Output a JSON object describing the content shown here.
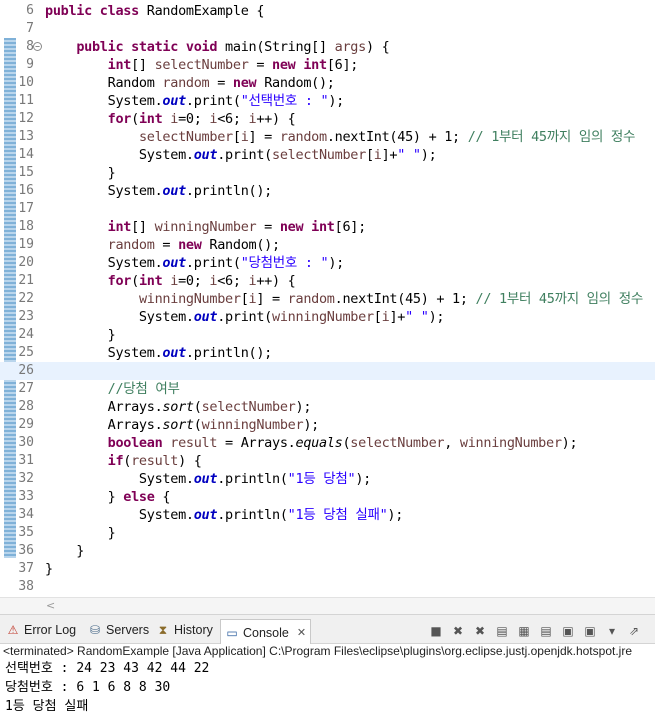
{
  "editor": {
    "lines": [
      {
        "n": "6",
        "tokens": [
          [
            "kw",
            "public class "
          ],
          [
            "",
            "RandomExample {"
          ]
        ]
      },
      {
        "n": "7",
        "tokens": []
      },
      {
        "n": "8",
        "fold": "⊖",
        "tokens": [
          [
            "",
            "    "
          ],
          [
            "kw",
            "public static void "
          ],
          [
            "",
            "main(String[] "
          ],
          [
            "var",
            "args"
          ],
          [
            "",
            ") {"
          ]
        ]
      },
      {
        "n": "9",
        "tokens": [
          [
            "",
            "        "
          ],
          [
            "kw",
            "int"
          ],
          [
            "",
            "[] "
          ],
          [
            "var",
            "selectNumber"
          ],
          [
            "",
            " = "
          ],
          [
            "kw",
            "new int"
          ],
          [
            "",
            "[6];"
          ]
        ]
      },
      {
        "n": "10",
        "tokens": [
          [
            "",
            "        Random "
          ],
          [
            "var",
            "random"
          ],
          [
            "",
            " = "
          ],
          [
            "kw",
            "new "
          ],
          [
            "",
            "Random();"
          ]
        ]
      },
      {
        "n": "11",
        "tokens": [
          [
            "",
            "        System."
          ],
          [
            "fld",
            "out"
          ],
          [
            "",
            ".print("
          ],
          [
            "str",
            "\"선택번호 : \""
          ],
          [
            "",
            ");"
          ]
        ]
      },
      {
        "n": "12",
        "tokens": [
          [
            "",
            "        "
          ],
          [
            "kw",
            "for"
          ],
          [
            "",
            "("
          ],
          [
            "kw",
            "int "
          ],
          [
            "var",
            "i"
          ],
          [
            "",
            "=0; "
          ],
          [
            "var",
            "i"
          ],
          [
            "",
            "<6; "
          ],
          [
            "var",
            "i"
          ],
          [
            "",
            "++) {"
          ]
        ]
      },
      {
        "n": "13",
        "tokens": [
          [
            "",
            "            "
          ],
          [
            "var",
            "selectNumber"
          ],
          [
            "",
            "["
          ],
          [
            "var",
            "i"
          ],
          [
            "",
            "] = "
          ],
          [
            "var",
            "random"
          ],
          [
            "",
            ".nextInt(45) + 1; "
          ],
          [
            "cmt",
            "// 1부터 45까지 임의 정수"
          ]
        ]
      },
      {
        "n": "14",
        "tokens": [
          [
            "",
            "            System."
          ],
          [
            "fld",
            "out"
          ],
          [
            "",
            ".print("
          ],
          [
            "var",
            "selectNumber"
          ],
          [
            "",
            "["
          ],
          [
            "var",
            "i"
          ],
          [
            "",
            "]+"
          ],
          [
            "str",
            "\" \""
          ],
          [
            "",
            ");"
          ]
        ]
      },
      {
        "n": "15",
        "tokens": [
          [
            "",
            "        }"
          ]
        ]
      },
      {
        "n": "16",
        "tokens": [
          [
            "",
            "        System."
          ],
          [
            "fld",
            "out"
          ],
          [
            "",
            ".println();"
          ]
        ]
      },
      {
        "n": "17",
        "tokens": []
      },
      {
        "n": "18",
        "tokens": [
          [
            "",
            "        "
          ],
          [
            "kw",
            "int"
          ],
          [
            "",
            "[] "
          ],
          [
            "var",
            "winningNumber"
          ],
          [
            "",
            " = "
          ],
          [
            "kw",
            "new int"
          ],
          [
            "",
            "[6];"
          ]
        ]
      },
      {
        "n": "19",
        "tokens": [
          [
            "",
            "        "
          ],
          [
            "var",
            "random"
          ],
          [
            "",
            " = "
          ],
          [
            "kw",
            "new "
          ],
          [
            "",
            "Random();"
          ]
        ]
      },
      {
        "n": "20",
        "tokens": [
          [
            "",
            "        System."
          ],
          [
            "fld",
            "out"
          ],
          [
            "",
            ".print("
          ],
          [
            "str",
            "\"당첨번호 : \""
          ],
          [
            "",
            ");"
          ]
        ]
      },
      {
        "n": "21",
        "tokens": [
          [
            "",
            "        "
          ],
          [
            "kw",
            "for"
          ],
          [
            "",
            "("
          ],
          [
            "kw",
            "int "
          ],
          [
            "var",
            "i"
          ],
          [
            "",
            "=0; "
          ],
          [
            "var",
            "i"
          ],
          [
            "",
            "<6; "
          ],
          [
            "var",
            "i"
          ],
          [
            "",
            "++) {"
          ]
        ]
      },
      {
        "n": "22",
        "tokens": [
          [
            "",
            "            "
          ],
          [
            "var",
            "winningNumber"
          ],
          [
            "",
            "["
          ],
          [
            "var",
            "i"
          ],
          [
            "",
            "] = "
          ],
          [
            "var",
            "random"
          ],
          [
            "",
            ".nextInt(45) + 1; "
          ],
          [
            "cmt",
            "// 1부터 45까지 임의 정수"
          ]
        ]
      },
      {
        "n": "23",
        "tokens": [
          [
            "",
            "            System."
          ],
          [
            "fld",
            "out"
          ],
          [
            "",
            ".print("
          ],
          [
            "var",
            "winningNumber"
          ],
          [
            "",
            "["
          ],
          [
            "var",
            "i"
          ],
          [
            "",
            "]+"
          ],
          [
            "str",
            "\" \""
          ],
          [
            "",
            ");"
          ]
        ]
      },
      {
        "n": "24",
        "tokens": [
          [
            "",
            "        }"
          ]
        ]
      },
      {
        "n": "25",
        "tokens": [
          [
            "",
            "        System."
          ],
          [
            "fld",
            "out"
          ],
          [
            "",
            ".println();"
          ]
        ]
      },
      {
        "n": "26",
        "highlight": true,
        "tokens": []
      },
      {
        "n": "27",
        "tokens": [
          [
            "",
            "        "
          ],
          [
            "cmt",
            "//당첨 여부"
          ]
        ]
      },
      {
        "n": "28",
        "tokens": [
          [
            "",
            "        Arrays."
          ],
          [
            "ital",
            "sort"
          ],
          [
            "",
            "("
          ],
          [
            "var",
            "selectNumber"
          ],
          [
            "",
            ");"
          ]
        ]
      },
      {
        "n": "29",
        "tokens": [
          [
            "",
            "        Arrays."
          ],
          [
            "ital",
            "sort"
          ],
          [
            "",
            "("
          ],
          [
            "var",
            "winningNumber"
          ],
          [
            "",
            ");"
          ]
        ]
      },
      {
        "n": "30",
        "tokens": [
          [
            "",
            "        "
          ],
          [
            "kw",
            "boolean "
          ],
          [
            "var",
            "result"
          ],
          [
            "",
            " = Arrays."
          ],
          [
            "ital",
            "equals"
          ],
          [
            "",
            "("
          ],
          [
            "var",
            "selectNumber"
          ],
          [
            "",
            ", "
          ],
          [
            "var",
            "winningNumber"
          ],
          [
            "",
            ");"
          ]
        ]
      },
      {
        "n": "31",
        "tokens": [
          [
            "",
            "        "
          ],
          [
            "kw",
            "if"
          ],
          [
            "",
            "("
          ],
          [
            "var",
            "result"
          ],
          [
            "",
            ") {"
          ]
        ]
      },
      {
        "n": "32",
        "tokens": [
          [
            "",
            "            System."
          ],
          [
            "fld",
            "out"
          ],
          [
            "",
            ".println("
          ],
          [
            "str",
            "\"1등 당첨\""
          ],
          [
            "",
            ");"
          ]
        ]
      },
      {
        "n": "33",
        "tokens": [
          [
            "",
            "        } "
          ],
          [
            "kw",
            "else "
          ],
          [
            "",
            "{"
          ]
        ]
      },
      {
        "n": "34",
        "tokens": [
          [
            "",
            "            System."
          ],
          [
            "fld",
            "out"
          ],
          [
            "",
            ".println("
          ],
          [
            "str",
            "\"1등 당첨 실패\""
          ],
          [
            "",
            ");"
          ]
        ]
      },
      {
        "n": "35",
        "tokens": [
          [
            "",
            "        }"
          ]
        ]
      },
      {
        "n": "36",
        "tokens": [
          [
            "",
            "    }"
          ]
        ]
      },
      {
        "n": "37",
        "tokens": [
          [
            "",
            "}"
          ]
        ]
      },
      {
        "n": "38",
        "tokens": []
      }
    ]
  },
  "scrollbar": {
    "left_arrow": "<"
  },
  "panel": {
    "tabs": [
      {
        "label": "Error Log",
        "icon": "error-log-icon",
        "glyph": "⚠",
        "color": "#c0392b"
      },
      {
        "label": "Servers",
        "icon": "servers-icon",
        "glyph": "⛁",
        "color": "#4a6b8a"
      },
      {
        "label": "History",
        "icon": "history-icon",
        "glyph": "⧗",
        "color": "#8a6b2a"
      },
      {
        "label": "Console",
        "icon": "console-icon",
        "glyph": "▭",
        "color": "#2d5fa0",
        "active": true,
        "close": "✕"
      }
    ],
    "toolbar": [
      "■",
      "✖",
      "✖",
      "▤",
      "▦",
      "▤",
      "▣",
      "▣",
      "▾",
      "⇗"
    ]
  },
  "status": "<terminated> RandomExample [Java Application] C:\\Program Files\\eclipse\\plugins\\org.eclipse.justj.openjdk.hotspot.jre",
  "console": {
    "lines": [
      "선택번호 : 24 23 43 42 44 22",
      "당첨번호 : 6 1 6 8 8 30",
      "1등 당첨 실패"
    ]
  },
  "colors": {
    "keyword": "#7f0055",
    "string": "#2a00ff",
    "comment": "#3f7f5f",
    "field": "#0000c0",
    "variable": "#6a3e3e"
  }
}
